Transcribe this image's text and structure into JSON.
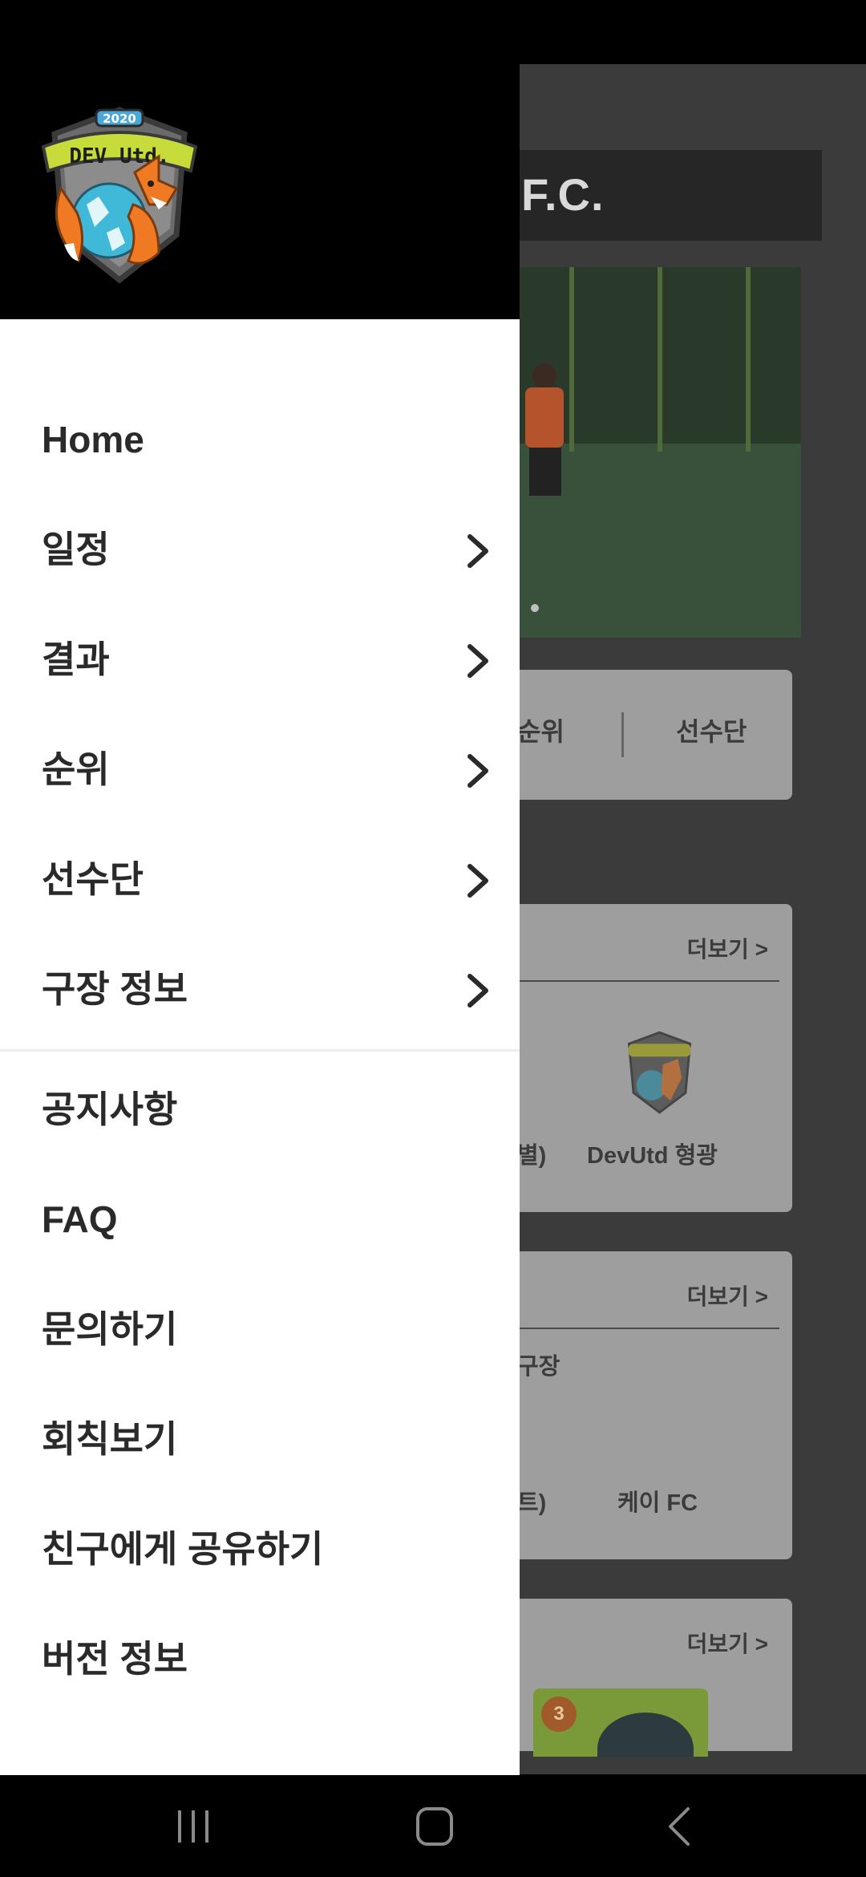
{
  "background_app": {
    "title": "F.C.",
    "tabs": [
      "순위",
      "선수단"
    ],
    "card1": {
      "more_label": "더보기 >",
      "cut_label": "별)",
      "player_name": "DevUtd 형광"
    },
    "card2": {
      "more_label": "더보기 >",
      "cut_label_1": "구장",
      "cut_label_2": "트)",
      "team_name": "케이 FC"
    },
    "card3": {
      "more_label": "더보기 >",
      "medal_rank": "3"
    }
  },
  "drawer": {
    "logo": {
      "year": "2020",
      "text": "DEV Utd."
    },
    "menu": [
      {
        "label": "Home",
        "has_submenu": false
      },
      {
        "label": "일정",
        "has_submenu": true
      },
      {
        "label": "결과",
        "has_submenu": true
      },
      {
        "label": "순위",
        "has_submenu": true
      },
      {
        "label": "선수단",
        "has_submenu": true
      },
      {
        "label": "구장 정보",
        "has_submenu": true
      }
    ],
    "menu_secondary": [
      {
        "label": "공지사항"
      },
      {
        "label": "FAQ"
      },
      {
        "label": "문의하기"
      },
      {
        "label": "회칙보기"
      },
      {
        "label": "친구에게 공유하기"
      },
      {
        "label": "버전 정보"
      }
    ]
  },
  "navbar": {
    "buttons": [
      "recent-apps-icon",
      "home-icon",
      "back-icon"
    ]
  },
  "colors": {
    "drawer_bg": "#ffffff",
    "header_bg": "#000000",
    "menu_text": "#2a2a2a",
    "scrim_bg": "#3b3b3b"
  }
}
